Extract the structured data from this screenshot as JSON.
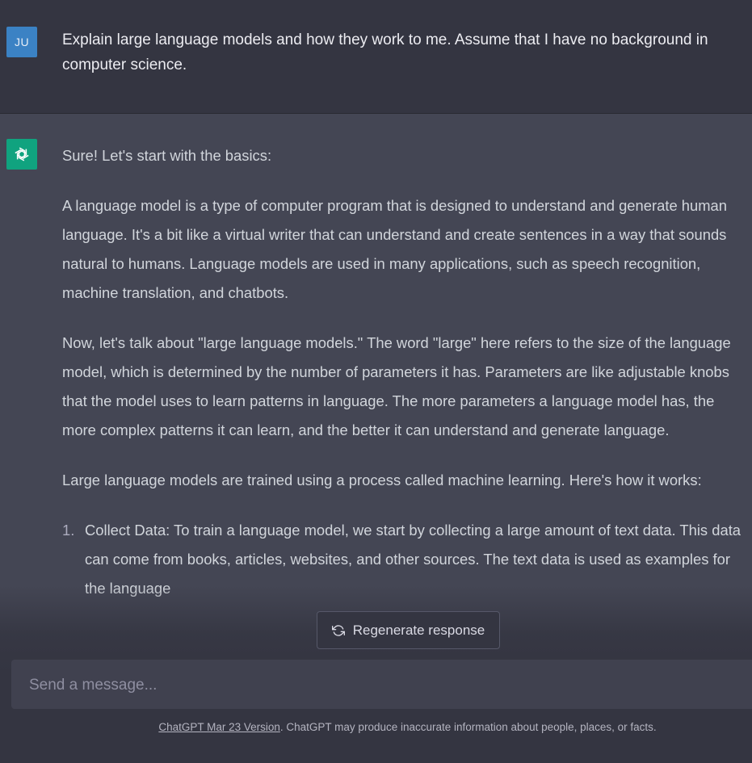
{
  "user_message": {
    "avatar": "JU",
    "text": "Explain large language models and how they work to me. Assume that I have no background in computer science."
  },
  "assistant_message": {
    "avatar_icon": "openai-logo-icon",
    "paragraphs": [
      "Sure! Let's start with the basics:",
      "A language model is a type of computer program that is designed to understand and generate human language. It's a bit like a virtual writer that can understand and create sentences in a way that sounds natural to humans. Language models are used in many applications, such as speech recognition, machine translation, and chatbots.",
      "Now, let's talk about \"large language models.\" The word \"large\" here refers to the size of the language model, which is determined by the number of parameters it has. Parameters are like adjustable knobs that the model uses to learn patterns in language. The more parameters a language model has, the more complex patterns it can learn, and the better it can understand and generate language.",
      "Large language models are trained using a process called machine learning. Here's how it works:"
    ],
    "list_items": [
      {
        "number": "1.",
        "text": "Collect Data: To train a language model, we start by collecting a large amount of text data. This data can come from books, articles, websites, and other sources. The text data is used as examples for the language"
      }
    ]
  },
  "regenerate": {
    "label": "Regenerate response",
    "icon": "refresh-icon"
  },
  "composer": {
    "placeholder": "Send a message..."
  },
  "footer": {
    "link_text": "ChatGPT Mar 23 Version",
    "text": ". ChatGPT may produce inaccurate information about people, places, or facts."
  },
  "colors": {
    "background": "#343541",
    "assistant_background": "#444654",
    "user_avatar": "#3b82c4",
    "assistant_avatar": "#10a37f",
    "input_background": "#40414f"
  }
}
